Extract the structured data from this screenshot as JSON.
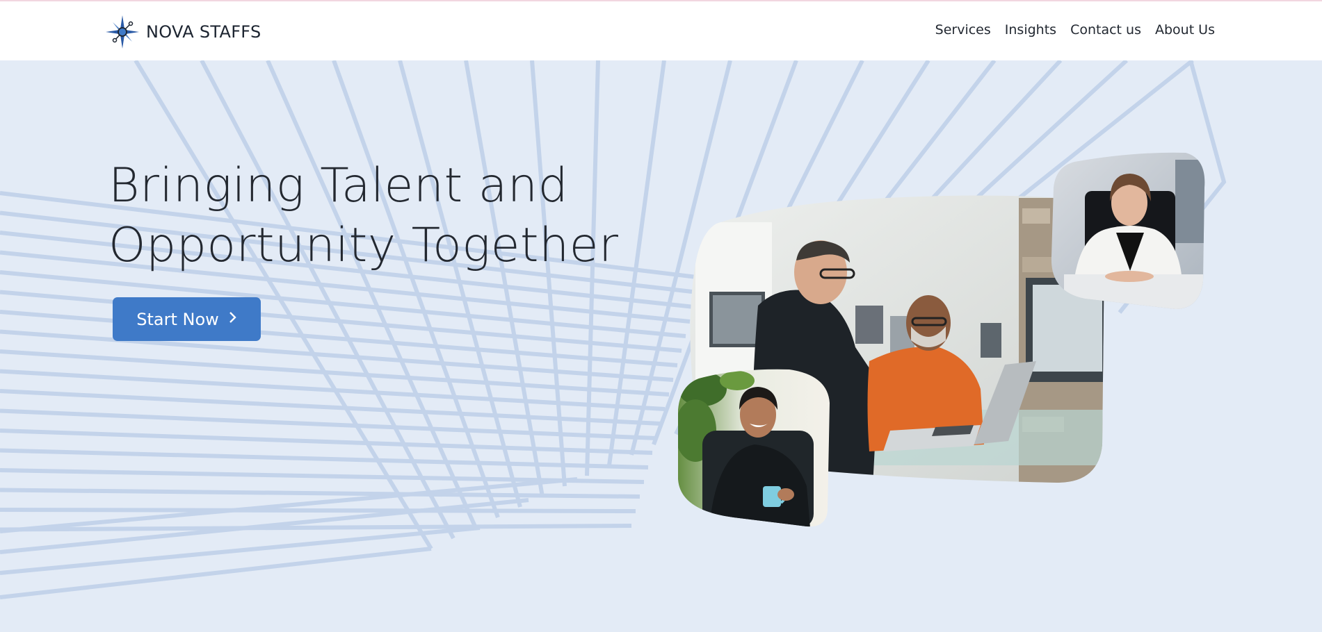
{
  "brand": {
    "name": "NOVA STAFFS",
    "logo_icon": "compass-star-icon",
    "accent": "#3f7ac8"
  },
  "nav": {
    "items": [
      "Services",
      "Insights",
      "Contact us",
      "About Us"
    ]
  },
  "hero": {
    "title_line1": "Bringing Talent and",
    "title_line2": "Opportunity Together",
    "cta_label": "Start Now",
    "cta_icon": "chevron-right-icon",
    "background": "#e3ebf6",
    "line_color": "#c3d3ea"
  },
  "photos": [
    {
      "name": "team-meeting-photo"
    },
    {
      "name": "businesswoman-photo"
    },
    {
      "name": "man-with-mug-photo"
    }
  ]
}
